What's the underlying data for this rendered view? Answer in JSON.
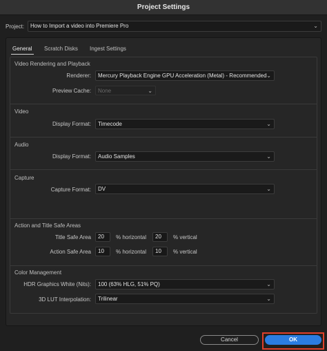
{
  "window": {
    "title": "Project Settings"
  },
  "project": {
    "label": "Project:",
    "value": "How to Import a video into Premiere Pro"
  },
  "tabs": [
    {
      "label": "General"
    },
    {
      "label": "Scratch Disks"
    },
    {
      "label": "Ingest Settings"
    }
  ],
  "video_rendering": {
    "title": "Video Rendering and Playback",
    "renderer_label": "Renderer:",
    "renderer_value": "Mercury Playback Engine GPU Acceleration (Metal) - Recommended",
    "preview_cache_label": "Preview Cache:",
    "preview_cache_value": "None"
  },
  "video": {
    "title": "Video",
    "display_format_label": "Display Format:",
    "display_format_value": "Timecode"
  },
  "audio": {
    "title": "Audio",
    "display_format_label": "Display Format:",
    "display_format_value": "Audio Samples"
  },
  "capture": {
    "title": "Capture",
    "capture_format_label": "Capture Format:",
    "capture_format_value": "DV"
  },
  "safe_areas": {
    "title": "Action and Title Safe Areas",
    "title_safe_label": "Title Safe Area",
    "title_safe_h": "20",
    "title_safe_v": "20",
    "action_safe_label": "Action Safe Area",
    "action_safe_h": "10",
    "action_safe_v": "10",
    "horizontal_unit": "% horizontal",
    "vertical_unit": "% vertical"
  },
  "color_management": {
    "title": "Color Management",
    "hdr_label": "HDR Graphics White (Nits):",
    "hdr_value": "100 (63% HLG, 51% PQ)",
    "lut_label": "3D LUT Interpolation:",
    "lut_value": "Trilinear"
  },
  "buttons": {
    "cancel": "Cancel",
    "ok": "OK"
  },
  "icons": {
    "dropdown": "chevron-down-icon"
  },
  "colors": {
    "accent": "#2b7de1",
    "highlight_frame": "#e0402a",
    "background": "#1f1f1f"
  }
}
